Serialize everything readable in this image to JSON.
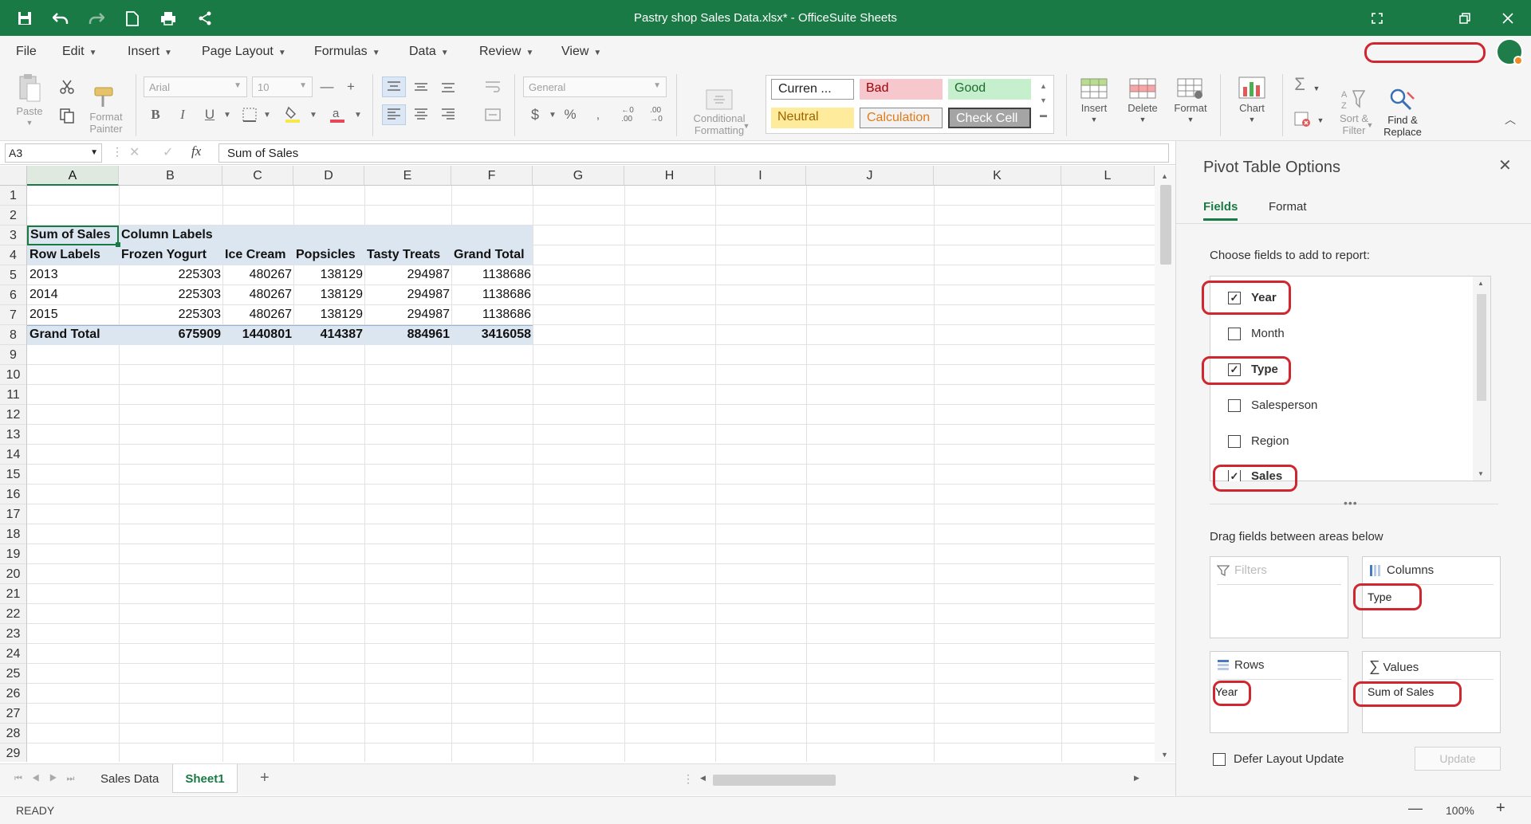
{
  "titlebar": {
    "title": "Pastry shop Sales Data.xlsx* - OfficeSuite Sheets"
  },
  "menu": [
    "File",
    "Edit",
    "Insert",
    "Page Layout",
    "Formulas",
    "Data",
    "Review",
    "View"
  ],
  "ribbon": {
    "paste": "Paste",
    "format_painter": "Format\nPainter",
    "font_name": "Arial",
    "font_size": "10",
    "number_format": "General",
    "conditional_formatting": "Conditional\nFormatting",
    "styles": {
      "currency": "Curren ...",
      "bad": "Bad",
      "good": "Good",
      "neutral": "Neutral",
      "calculation": "Calculation",
      "check_cell": "Check Cell"
    },
    "insert": "Insert",
    "delete": "Delete",
    "format": "Format",
    "chart": "Chart",
    "sort_filter": "Sort &\nFilter",
    "find_replace": "Find &\nReplace"
  },
  "formula_bar": {
    "name_box": "A3",
    "formula": "Sum of Sales"
  },
  "columns": [
    "A",
    "B",
    "C",
    "D",
    "E",
    "F",
    "G",
    "H",
    "I",
    "J",
    "K",
    "L"
  ],
  "rows": [
    "1",
    "2",
    "3",
    "4",
    "5",
    "6",
    "7",
    "8",
    "9",
    "10",
    "11",
    "12",
    "13",
    "14",
    "15",
    "16",
    "17",
    "18",
    "19",
    "20",
    "21",
    "22",
    "23",
    "24",
    "25",
    "26",
    "27",
    "28",
    "29"
  ],
  "pivot": {
    "header": {
      "a": "Sum of Sales",
      "b": "Column Labels"
    },
    "col_headers": [
      "Row Labels",
      "Frozen Yogurt",
      "Ice Cream",
      "Popsicles",
      "Tasty Treats",
      "Grand Total"
    ],
    "data_rows": [
      [
        "2013",
        "225303",
        "480267",
        "138129",
        "294987",
        "1138686"
      ],
      [
        "2014",
        "225303",
        "480267",
        "138129",
        "294987",
        "1138686"
      ],
      [
        "2015",
        "225303",
        "480267",
        "138129",
        "294987",
        "1138686"
      ]
    ],
    "total": [
      "Grand Total",
      "675909",
      "1440801",
      "414387",
      "884961",
      "3416058"
    ]
  },
  "sheets": [
    "Sales Data",
    "Sheet1"
  ],
  "status": {
    "ready": "READY",
    "zoom": "100%"
  },
  "panel": {
    "title": "Pivot Table Options",
    "tabs": [
      "Fields",
      "Format"
    ],
    "choose_label": "Choose fields to add to report:",
    "fields": [
      {
        "name": "Year",
        "checked": true
      },
      {
        "name": "Month",
        "checked": false
      },
      {
        "name": "Type",
        "checked": true
      },
      {
        "name": "Salesperson",
        "checked": false
      },
      {
        "name": "Region",
        "checked": false
      },
      {
        "name": "Sales",
        "checked": true
      }
    ],
    "drag_label": "Drag fields between areas below",
    "areas": {
      "filters": "Filters",
      "columns": "Columns",
      "rows": "Rows",
      "values": "Values"
    },
    "area_items": {
      "columns": "Type",
      "rows": "Year",
      "values": "Sum of Sales"
    },
    "defer": "Defer Layout Update",
    "update": "Update"
  },
  "colors": {
    "brand": "#1a7a45",
    "highlight": "#d0262f",
    "pivot_header": "#dce6f1"
  }
}
